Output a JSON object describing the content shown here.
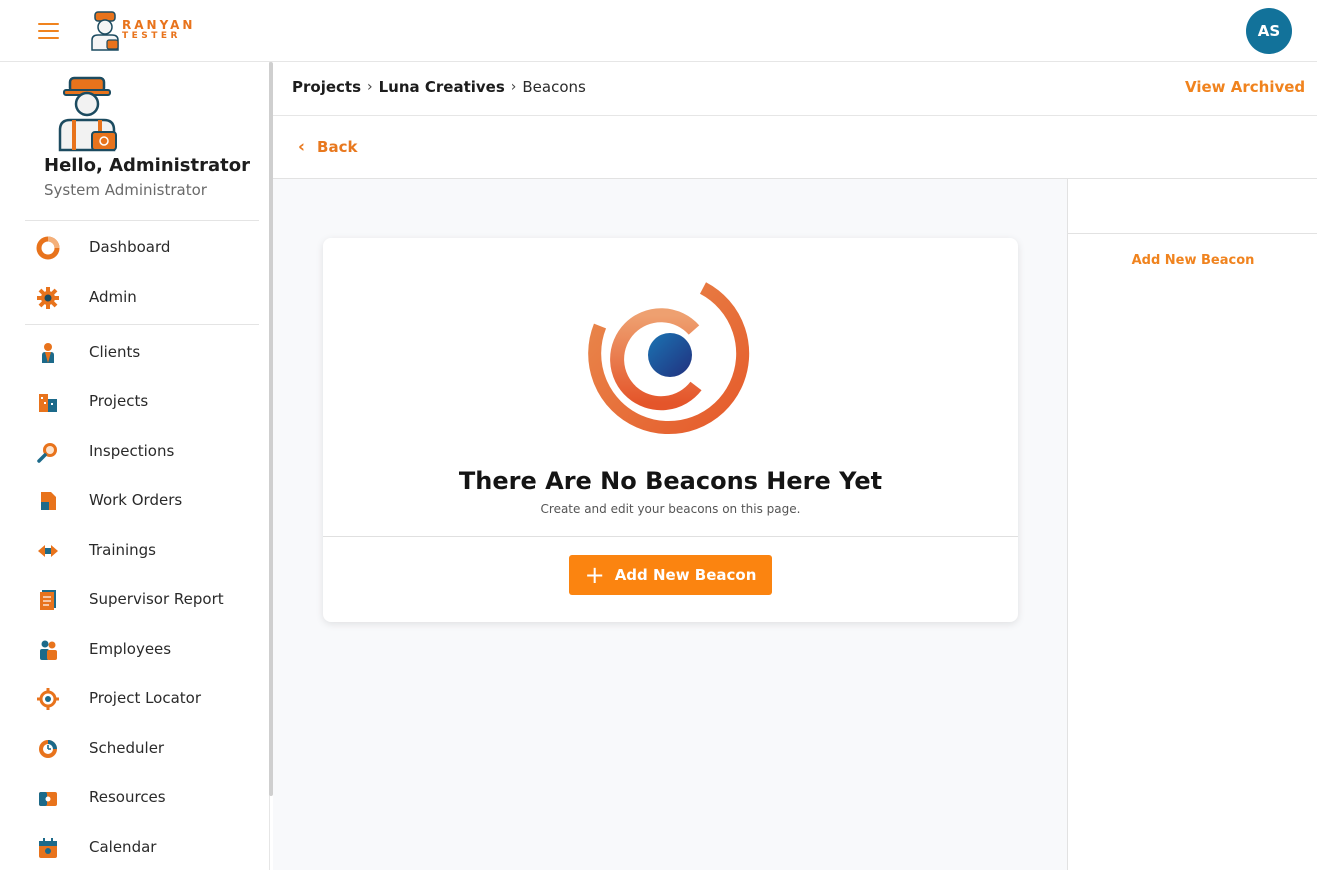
{
  "brand": {
    "line1": "RANYAN",
    "line2": "TESTER"
  },
  "user": {
    "initials": "AS",
    "greeting": "Hello, Administrator",
    "role": "System Administrator"
  },
  "sidebar": {
    "items": [
      {
        "label": "Dashboard",
        "icon": "dashboard-icon"
      },
      {
        "label": "Admin",
        "icon": "gear-icon"
      },
      {
        "label": "Clients",
        "icon": "person-icon"
      },
      {
        "label": "Projects",
        "icon": "building-icon"
      },
      {
        "label": "Inspections",
        "icon": "magnifier-icon"
      },
      {
        "label": "Work Orders",
        "icon": "work-order-icon"
      },
      {
        "label": "Trainings",
        "icon": "training-icon"
      },
      {
        "label": "Supervisor Report",
        "icon": "report-icon"
      },
      {
        "label": "Employees",
        "icon": "employees-icon"
      },
      {
        "label": "Project Locator",
        "icon": "locator-icon"
      },
      {
        "label": "Scheduler",
        "icon": "scheduler-icon"
      },
      {
        "label": "Resources",
        "icon": "resources-icon"
      },
      {
        "label": "Calendar",
        "icon": "calendar-icon"
      }
    ]
  },
  "breadcrumb": {
    "items": [
      "Projects",
      "Luna Creatives"
    ],
    "current": "Beacons"
  },
  "header": {
    "view_archived": "View Archived",
    "back": "Back"
  },
  "empty_state": {
    "title": "There Are No Beacons Here Yet",
    "subtitle": "Create and edit your beacons on this page.",
    "button": "Add New Beacon",
    "icon": "beacon-icon"
  },
  "right_panel": {
    "add_link": "Add New Beacon"
  },
  "colors": {
    "accent": "#f0831e",
    "button": "#fb8410",
    "avatar": "#12729a"
  }
}
